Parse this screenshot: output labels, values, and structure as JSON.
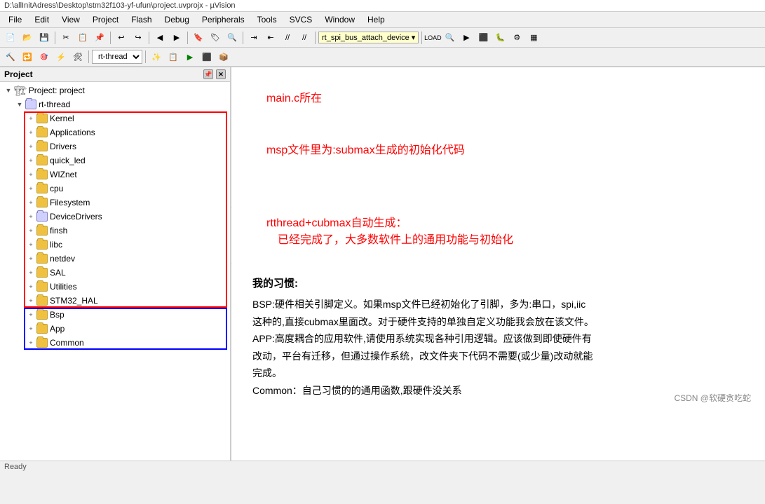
{
  "titleBar": {
    "text": "D:\\allInitAdress\\Desktop\\stm32f103-yf-ufun\\project.uvprojx - µVision"
  },
  "menuBar": {
    "items": [
      "File",
      "Edit",
      "View",
      "Project",
      "Flash",
      "Debug",
      "Peripherals",
      "Tools",
      "SVCS",
      "Window",
      "Help"
    ]
  },
  "toolbar2": {
    "comboLabel": "rt-thread",
    "targetCombo": "rt_spi_bus_attach_device ▾"
  },
  "leftPanel": {
    "title": "Project",
    "projectLabel": "Project: project",
    "tree": [
      {
        "id": "rt-thread",
        "label": "rt-thread",
        "indent": 1,
        "type": "root",
        "expanded": true
      },
      {
        "id": "kernel",
        "label": "Kernel",
        "indent": 2,
        "type": "folder",
        "expanded": false
      },
      {
        "id": "applications",
        "label": "Applications",
        "indent": 2,
        "type": "folder",
        "expanded": false
      },
      {
        "id": "drivers",
        "label": "Drivers",
        "indent": 2,
        "type": "folder",
        "expanded": false,
        "highlight": "red"
      },
      {
        "id": "quick_led",
        "label": "quick_led",
        "indent": 2,
        "type": "folder",
        "expanded": false
      },
      {
        "id": "wiznet",
        "label": "WIZnet",
        "indent": 2,
        "type": "folder",
        "expanded": false
      },
      {
        "id": "cpu",
        "label": "cpu",
        "indent": 2,
        "type": "folder",
        "expanded": false
      },
      {
        "id": "filesystem",
        "label": "Filesystem",
        "indent": 2,
        "type": "folder",
        "expanded": false
      },
      {
        "id": "devicedrivers",
        "label": "DeviceDrivers",
        "indent": 2,
        "type": "folder-special",
        "expanded": false
      },
      {
        "id": "finsh",
        "label": "finsh",
        "indent": 2,
        "type": "folder",
        "expanded": false
      },
      {
        "id": "libc",
        "label": "libc",
        "indent": 2,
        "type": "folder",
        "expanded": false
      },
      {
        "id": "netdev",
        "label": "netdev",
        "indent": 2,
        "type": "folder",
        "expanded": false
      },
      {
        "id": "sal",
        "label": "SAL",
        "indent": 2,
        "type": "folder",
        "expanded": false
      },
      {
        "id": "utilities",
        "label": "Utilities",
        "indent": 2,
        "type": "folder",
        "expanded": false
      },
      {
        "id": "stm32_hal",
        "label": "STM32_HAL",
        "indent": 2,
        "type": "folder",
        "expanded": false
      },
      {
        "id": "bsp",
        "label": "Bsp",
        "indent": 2,
        "type": "folder",
        "expanded": false
      },
      {
        "id": "app",
        "label": "App",
        "indent": 2,
        "type": "folder",
        "expanded": false
      },
      {
        "id": "common",
        "label": "Common",
        "indent": 2,
        "type": "folder",
        "expanded": false,
        "highlight": "blue"
      }
    ]
  },
  "annotations": [
    {
      "id": "annotation1",
      "text": "main.c所在"
    },
    {
      "id": "annotation2",
      "text": "msp文件里为:submax生成的初始化代码"
    },
    {
      "id": "annotation3",
      "text": "rtthread+cubmax自动生成：",
      "text2": "已经完成了，大多数软件上的通用功能与初始化"
    }
  ],
  "bottomText": {
    "habitTitle": "我的习惯:",
    "lines": [
      "BSP:硬件相关引脚定义。如果msp文件已经初始化了引脚，多为:串口，spi,iic",
      "这种的,直接cubmax里面改。对于硬件支持的单独自定义功能我会放在该文件。",
      "APP:高度耦合的应用软件,请使用系统实现各种引用逻辑。应该做到即使硬件有",
      "改动，平台有迁移，但通过操作系统，改文件夹下代码不需要(或少量)改动就能",
      "完成。",
      "Common：自己习惯的的通用函数,跟硬件没关系"
    ],
    "csdnTag": "CSDN @软硬贪吃蛇"
  }
}
